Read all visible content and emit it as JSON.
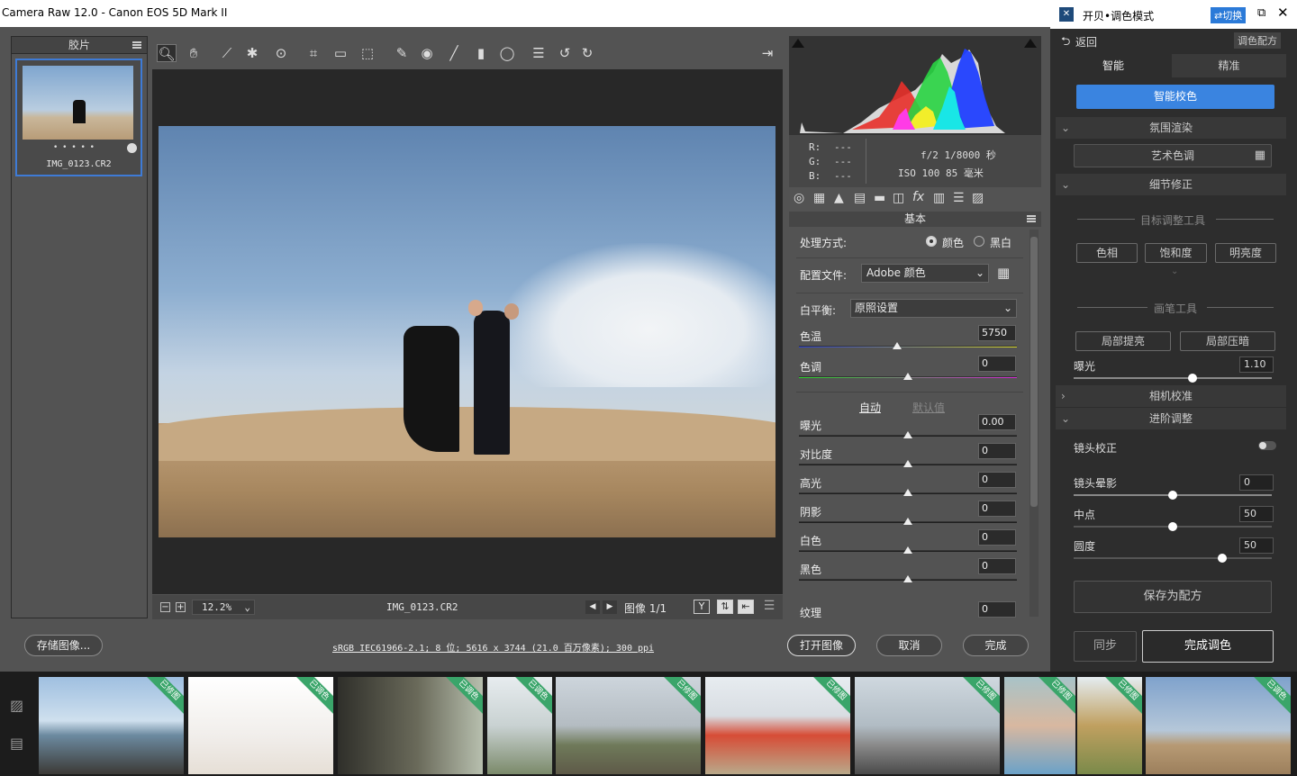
{
  "title_bar": {
    "text": "Camera Raw 12.0 -  Canon EOS 5D Mark II"
  },
  "filmstrip": {
    "header": "胶片",
    "thumb_caption": "IMG_0123.CR2",
    "rating_dots": "• • • • •"
  },
  "histogram": {
    "r_label": "R:",
    "g_label": "G:",
    "b_label": "B:",
    "r_val": "---",
    "g_val": "---",
    "b_val": "---",
    "exposure": "f/2   1/8000 秒",
    "iso": "ISO 100   85 毫米"
  },
  "panel": {
    "section_title": "基本",
    "process_label": "处理方式:",
    "process_color": "颜色",
    "process_bw": "黑白",
    "profile_label": "配置文件:",
    "profile_value": "Adobe 颜色",
    "wb_label": "白平衡:",
    "wb_value": "原照设置",
    "auto_label": "自动",
    "default_label": "默认值",
    "sliders": [
      {
        "label": "色温",
        "value": "5750",
        "fraction": 0.45
      },
      {
        "label": "色调",
        "value": "0",
        "fraction": 0.5
      },
      {
        "label": "曝光",
        "value": "0.00",
        "fraction": 0.5
      },
      {
        "label": "对比度",
        "value": "0",
        "fraction": 0.5
      },
      {
        "label": "高光",
        "value": "0",
        "fraction": 0.5
      },
      {
        "label": "阴影",
        "value": "0",
        "fraction": 0.5
      },
      {
        "label": "白色",
        "value": "0",
        "fraction": 0.5
      },
      {
        "label": "黑色",
        "value": "0",
        "fraction": 0.5
      },
      {
        "label": "纹理",
        "value": "0",
        "fraction": 0.5
      }
    ]
  },
  "zoombar": {
    "zoom": "12.2%",
    "filename": "IMG_0123.CR2",
    "image_count": "图像 1/1"
  },
  "bottom": {
    "save_button": "存储图像...",
    "info_link": "sRGB IEC61966-2.1; 8 位; 5616 x 3744 (21.0 百万像素); 300 ppi",
    "open_button": "打开图像",
    "cancel_button": "取消",
    "done_button": "完成"
  },
  "kaibei": {
    "title": "开贝•调色模式",
    "switch_label": "⇄切换",
    "back_label": "返回",
    "preset_label": "调色配方",
    "tab_smart": "智能",
    "tab_fine": "精准",
    "smart_button": "智能校色",
    "sec_atmos": "氛围渲染",
    "art_button": "艺术色调",
    "sec_detail": "细节修正",
    "target_tool": "目标调整工具",
    "hue_btn": "色相",
    "sat_btn": "饱和度",
    "lum_btn": "明亮度",
    "brush_tool": "画笔工具",
    "local_bright": "局部提亮",
    "local_dark": "局部压暗",
    "exposure_label": "曝光",
    "exposure_value": "1.10",
    "exposure_fraction": 0.6,
    "sec_camera": "相机校准",
    "sec_advanced": "进阶调整",
    "lens_label": "镜头校正",
    "vignette_label": "镜头晕影",
    "vignette_value": "0",
    "vignette_fraction": 0.5,
    "midpoint_label": "中点",
    "midpoint_value": "50",
    "midpoint_fraction": 0.5,
    "roundness_label": "圆度",
    "roundness_value": "50",
    "roundness_fraction": 0.75,
    "save_preset": "保存为配方",
    "sync_button": "同步",
    "finish_button": "完成调色"
  },
  "strip_badges": [
    "已修图",
    "已调色",
    "已调色",
    "已调色",
    "已修图",
    "已修图",
    "已修图",
    "已修图",
    "已修图",
    "已调色"
  ]
}
